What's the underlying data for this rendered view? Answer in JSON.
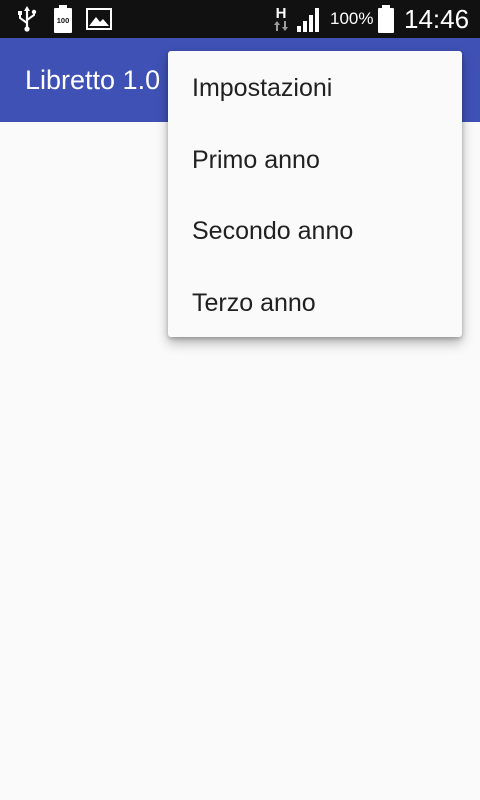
{
  "status_bar": {
    "battery_percent": "100%",
    "clock": "14:46",
    "network_type": "H",
    "small_battery_label": "100",
    "icons": [
      "usb-icon",
      "battery-icon",
      "image-icon",
      "hspa-data-icon",
      "signal-icon",
      "battery-icon"
    ]
  },
  "app_bar": {
    "title": "Libretto 1.0"
  },
  "menu": {
    "items": [
      {
        "label": "Impostazioni"
      },
      {
        "label": "Primo anno"
      },
      {
        "label": "Secondo anno"
      },
      {
        "label": "Terzo anno"
      }
    ]
  },
  "colors": {
    "status_bar": "#111111",
    "app_bar": "#3f51b5",
    "background": "#fafafa",
    "menu_text": "#212121"
  }
}
